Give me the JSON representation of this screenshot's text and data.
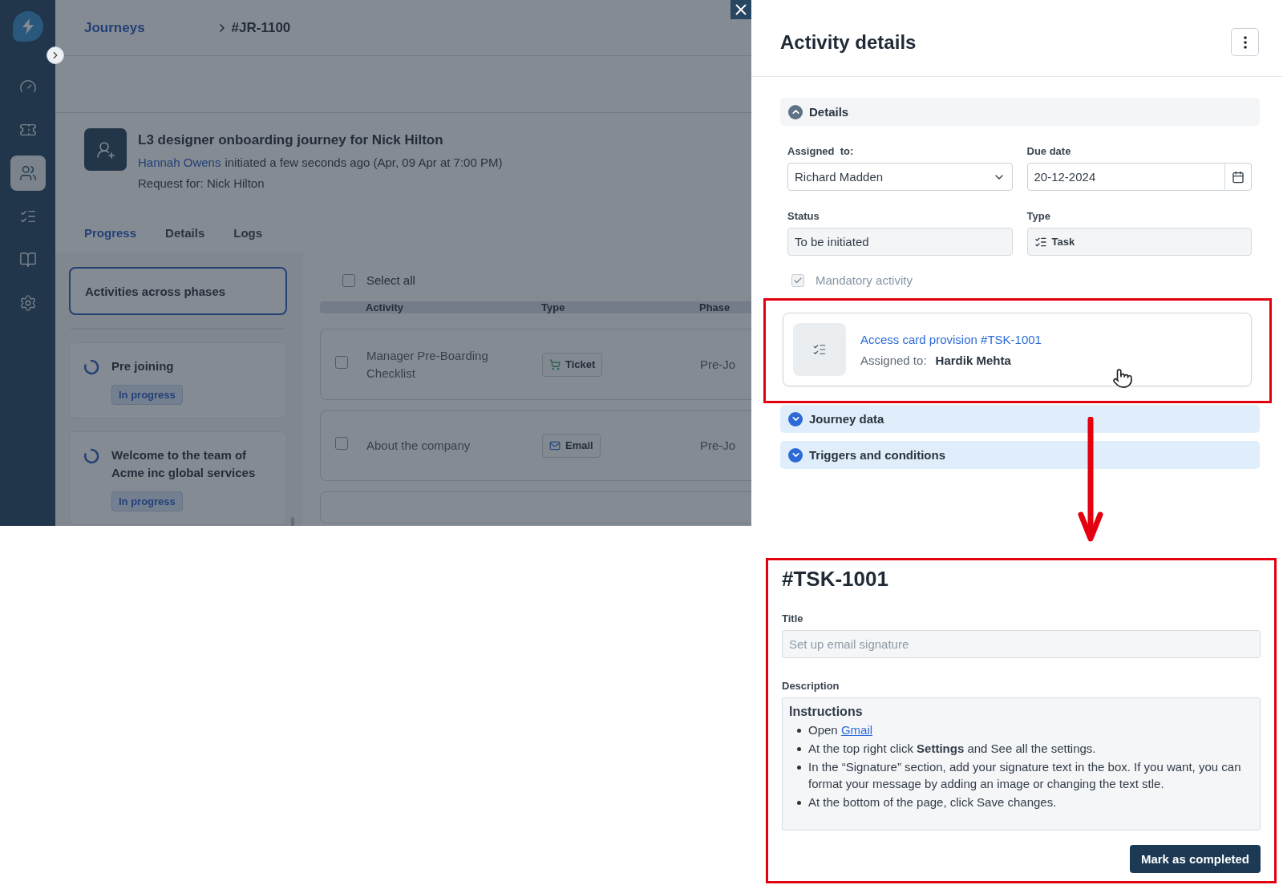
{
  "sidebar": {
    "items": [
      {
        "selected": false
      },
      {
        "selected": false
      },
      {
        "selected": true
      },
      {
        "selected": false
      },
      {
        "selected": false
      },
      {
        "selected": false
      }
    ]
  },
  "breadcrumb": {
    "parent": "Journeys",
    "current": "#JR-1100"
  },
  "journey": {
    "title": "L3 designer onboarding journey for Nick Hilton",
    "initiator": "Hannah Owens",
    "initiated": "initiated a few seconds ago (Apr, 09 Apr at 7:00 PM)",
    "request_for": "Request for: Nick Hilton"
  },
  "tabs": [
    {
      "label": "Progress",
      "selected": true
    },
    {
      "label": "Details",
      "selected": false
    },
    {
      "label": "Logs",
      "selected": false
    }
  ],
  "phases": {
    "overview": {
      "label": "Activities across phases",
      "selected": true
    },
    "items": [
      {
        "name": "Pre joining",
        "status": "In progress"
      },
      {
        "name": "Welcome to the team of Acme inc global services",
        "status": "In progress"
      }
    ]
  },
  "activities": {
    "select_all": {
      "label": "Select all",
      "checked": false
    },
    "columns": [
      "Activity",
      "Type",
      "Phase"
    ],
    "rows": [
      {
        "checked": false,
        "name": "Manager Pre-Boarding Checklist",
        "type": {
          "kind": "ticket",
          "label": "Ticket"
        },
        "phase": "Pre-Jo"
      },
      {
        "checked": false,
        "name": "About the company",
        "type": {
          "kind": "email",
          "label": "Email"
        },
        "phase": "Pre-Jo"
      }
    ]
  },
  "drawer": {
    "title": "Activity details",
    "sections": [
      {
        "title": "Details",
        "expanded": true
      },
      {
        "title": "Journey data",
        "expanded": false
      },
      {
        "title": "Triggers and conditions",
        "expanded": false
      }
    ],
    "fields": {
      "assigned_to": {
        "label": "Assigned  to:",
        "value": "Richard Madden"
      },
      "due_date": {
        "label": "Due date",
        "value": "20-12-2024"
      },
      "status": {
        "label": "Status",
        "value": "To be initiated"
      },
      "type": {
        "label": "Type",
        "value": "Task"
      }
    },
    "mandatory": {
      "label": "Mandatory activity",
      "checked": true,
      "disabled": true
    },
    "linked_task": {
      "title": "Access card provision #TSK-1001",
      "assignee_label": "Assigned to:",
      "assignee": "Hardik Mehta"
    }
  },
  "task": {
    "id": "#TSK-1001",
    "title_label": "Title",
    "title_value": "Set up email signature",
    "description_label": "Description",
    "description": {
      "heading": "Instructions",
      "items": [
        {
          "text": "Open ",
          "link": "Gmail"
        },
        {
          "text": "At the top right click **Settings** and See all the settings."
        },
        {
          "text": "In the “Signature” section, add your signature text in the box. If you want, you can format your message by adding an image or changing the text stle."
        },
        {
          "text": "At the bottom of the page, click Save changes."
        }
      ]
    },
    "action": "Mark as completed"
  }
}
